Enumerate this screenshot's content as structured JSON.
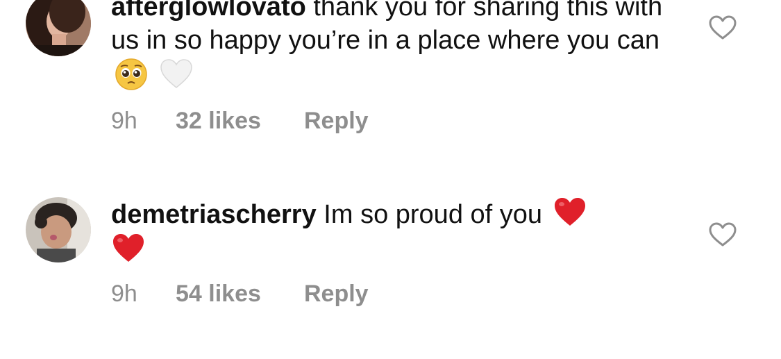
{
  "comments": [
    {
      "username": "afterglowlovato",
      "text": "thank you for sharing this with us in so happy you’re in a place where you can",
      "emojis": [
        "pleading-face-emoji",
        "white-heart-emoji"
      ],
      "time": "9h",
      "likes": "32 likes",
      "reply_label": "Reply"
    },
    {
      "username": "demetriascherry",
      "text": "Im so proud of you",
      "emojis": [
        "red-heart-emoji",
        "red-heart-emoji"
      ],
      "time": "9h",
      "likes": "54 likes",
      "reply_label": "Reply"
    }
  ],
  "icons": {
    "like": "heart-outline-icon"
  },
  "colors": {
    "text": "#111111",
    "meta": "#8e8e8e",
    "heart_red": "#e0202a",
    "icon_gray": "#8e8e8e"
  }
}
